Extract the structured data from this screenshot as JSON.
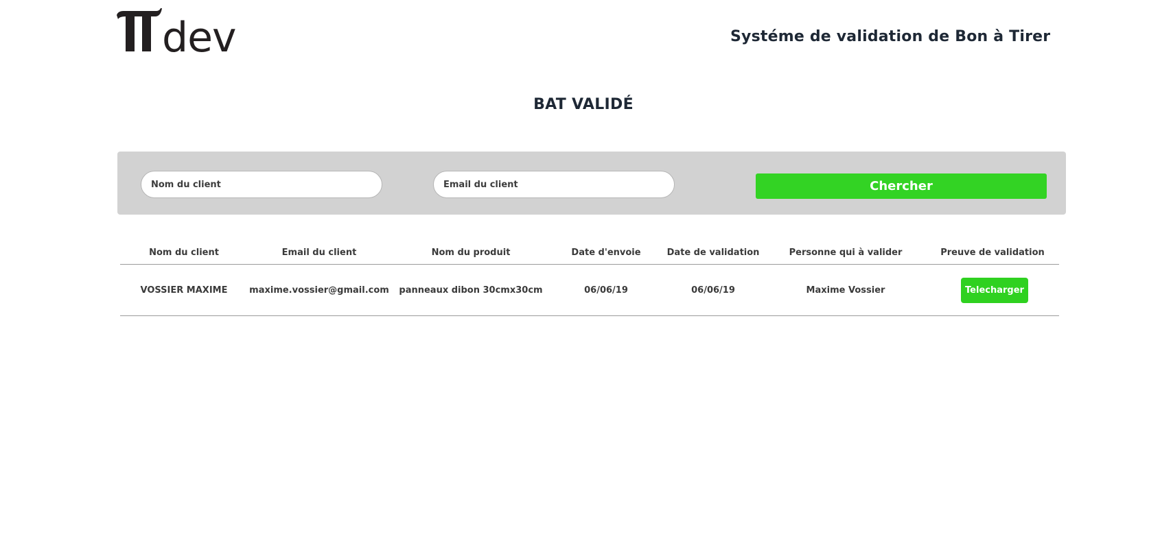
{
  "header": {
    "logo_text": "TTdev",
    "app_title": "Systéme de validation de Bon à Tirer"
  },
  "page": {
    "title": "BAT VALIDÉ"
  },
  "search": {
    "name_placeholder": "Nom du client",
    "email_placeholder": "Email du client",
    "button_label": "Chercher",
    "button_color": "#33d324"
  },
  "table": {
    "columns": [
      "Nom du client",
      "Email du client",
      "Nom du produit",
      "Date d'envoie",
      "Date de validation",
      "Personne qui à valider",
      "Preuve de validation"
    ],
    "rows": [
      {
        "client_name": "VOSSIER MAXIME",
        "client_email": "maxime.vossier@gmail.com",
        "product_name": "panneaux dibon 30cmx30cm",
        "sent_date": "06/06/19",
        "validation_date": "06/06/19",
        "validated_by": "Maxime Vossier",
        "proof_button_label": "Telecharger"
      }
    ]
  },
  "colors": {
    "accent_green": "#33d324",
    "panel_gray": "#d2d2d2",
    "heading_dark": "#1e2835"
  }
}
